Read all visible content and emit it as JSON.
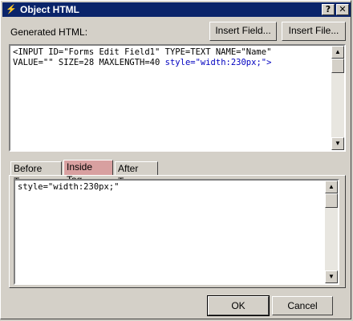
{
  "window": {
    "title": "Object HTML",
    "help_label": "?",
    "close_label": "✕",
    "app_icon": "⚡"
  },
  "generated": {
    "label": "Generated HTML:",
    "insert_field_label": "Insert Field...",
    "insert_file_label": "Insert File...",
    "line1": "<INPUT ID=\"Forms Edit Field1\" TYPE=TEXT NAME=\"Name\"",
    "line2_plain": "VALUE=\"\" SIZE=28 MAXLENGTH=40 ",
    "line2_style": "style=\"width:230px;\">"
  },
  "tabs": [
    {
      "label": "Before Tag"
    },
    {
      "label": "Inside Tag",
      "active": true
    },
    {
      "label": "After Tag"
    }
  ],
  "editor": {
    "text": "style=\"width:230px;\""
  },
  "footer": {
    "ok_label": "OK",
    "cancel_label": "Cancel"
  },
  "colors": {
    "titlebar": "#0a246a",
    "active_tab": "#d8a0a0",
    "code_highlight": "#0000c0"
  }
}
